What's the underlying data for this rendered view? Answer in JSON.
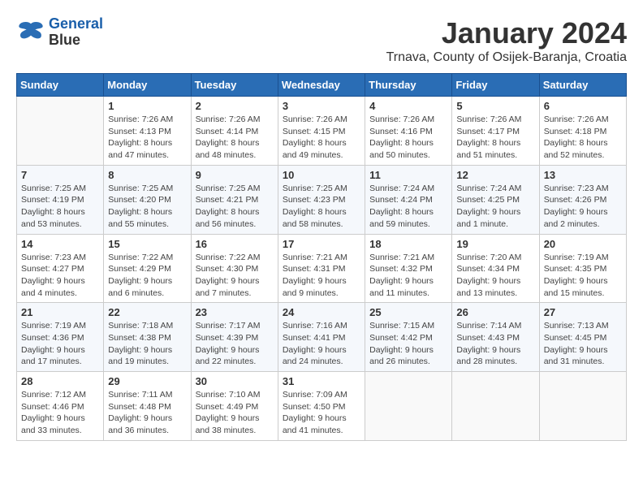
{
  "header": {
    "logo_line1": "General",
    "logo_line2": "Blue",
    "month_title": "January 2024",
    "location": "Trnava, County of Osijek-Baranja, Croatia"
  },
  "days_of_week": [
    "Sunday",
    "Monday",
    "Tuesday",
    "Wednesday",
    "Thursday",
    "Friday",
    "Saturday"
  ],
  "weeks": [
    [
      {
        "day": "",
        "info": ""
      },
      {
        "day": "1",
        "info": "Sunrise: 7:26 AM\nSunset: 4:13 PM\nDaylight: 8 hours\nand 47 minutes."
      },
      {
        "day": "2",
        "info": "Sunrise: 7:26 AM\nSunset: 4:14 PM\nDaylight: 8 hours\nand 48 minutes."
      },
      {
        "day": "3",
        "info": "Sunrise: 7:26 AM\nSunset: 4:15 PM\nDaylight: 8 hours\nand 49 minutes."
      },
      {
        "day": "4",
        "info": "Sunrise: 7:26 AM\nSunset: 4:16 PM\nDaylight: 8 hours\nand 50 minutes."
      },
      {
        "day": "5",
        "info": "Sunrise: 7:26 AM\nSunset: 4:17 PM\nDaylight: 8 hours\nand 51 minutes."
      },
      {
        "day": "6",
        "info": "Sunrise: 7:26 AM\nSunset: 4:18 PM\nDaylight: 8 hours\nand 52 minutes."
      }
    ],
    [
      {
        "day": "7",
        "info": "Sunrise: 7:25 AM\nSunset: 4:19 PM\nDaylight: 8 hours\nand 53 minutes."
      },
      {
        "day": "8",
        "info": "Sunrise: 7:25 AM\nSunset: 4:20 PM\nDaylight: 8 hours\nand 55 minutes."
      },
      {
        "day": "9",
        "info": "Sunrise: 7:25 AM\nSunset: 4:21 PM\nDaylight: 8 hours\nand 56 minutes."
      },
      {
        "day": "10",
        "info": "Sunrise: 7:25 AM\nSunset: 4:23 PM\nDaylight: 8 hours\nand 58 minutes."
      },
      {
        "day": "11",
        "info": "Sunrise: 7:24 AM\nSunset: 4:24 PM\nDaylight: 8 hours\nand 59 minutes."
      },
      {
        "day": "12",
        "info": "Sunrise: 7:24 AM\nSunset: 4:25 PM\nDaylight: 9 hours\nand 1 minute."
      },
      {
        "day": "13",
        "info": "Sunrise: 7:23 AM\nSunset: 4:26 PM\nDaylight: 9 hours\nand 2 minutes."
      }
    ],
    [
      {
        "day": "14",
        "info": "Sunrise: 7:23 AM\nSunset: 4:27 PM\nDaylight: 9 hours\nand 4 minutes."
      },
      {
        "day": "15",
        "info": "Sunrise: 7:22 AM\nSunset: 4:29 PM\nDaylight: 9 hours\nand 6 minutes."
      },
      {
        "day": "16",
        "info": "Sunrise: 7:22 AM\nSunset: 4:30 PM\nDaylight: 9 hours\nand 7 minutes."
      },
      {
        "day": "17",
        "info": "Sunrise: 7:21 AM\nSunset: 4:31 PM\nDaylight: 9 hours\nand 9 minutes."
      },
      {
        "day": "18",
        "info": "Sunrise: 7:21 AM\nSunset: 4:32 PM\nDaylight: 9 hours\nand 11 minutes."
      },
      {
        "day": "19",
        "info": "Sunrise: 7:20 AM\nSunset: 4:34 PM\nDaylight: 9 hours\nand 13 minutes."
      },
      {
        "day": "20",
        "info": "Sunrise: 7:19 AM\nSunset: 4:35 PM\nDaylight: 9 hours\nand 15 minutes."
      }
    ],
    [
      {
        "day": "21",
        "info": "Sunrise: 7:19 AM\nSunset: 4:36 PM\nDaylight: 9 hours\nand 17 minutes."
      },
      {
        "day": "22",
        "info": "Sunrise: 7:18 AM\nSunset: 4:38 PM\nDaylight: 9 hours\nand 19 minutes."
      },
      {
        "day": "23",
        "info": "Sunrise: 7:17 AM\nSunset: 4:39 PM\nDaylight: 9 hours\nand 22 minutes."
      },
      {
        "day": "24",
        "info": "Sunrise: 7:16 AM\nSunset: 4:41 PM\nDaylight: 9 hours\nand 24 minutes."
      },
      {
        "day": "25",
        "info": "Sunrise: 7:15 AM\nSunset: 4:42 PM\nDaylight: 9 hours\nand 26 minutes."
      },
      {
        "day": "26",
        "info": "Sunrise: 7:14 AM\nSunset: 4:43 PM\nDaylight: 9 hours\nand 28 minutes."
      },
      {
        "day": "27",
        "info": "Sunrise: 7:13 AM\nSunset: 4:45 PM\nDaylight: 9 hours\nand 31 minutes."
      }
    ],
    [
      {
        "day": "28",
        "info": "Sunrise: 7:12 AM\nSunset: 4:46 PM\nDaylight: 9 hours\nand 33 minutes."
      },
      {
        "day": "29",
        "info": "Sunrise: 7:11 AM\nSunset: 4:48 PM\nDaylight: 9 hours\nand 36 minutes."
      },
      {
        "day": "30",
        "info": "Sunrise: 7:10 AM\nSunset: 4:49 PM\nDaylight: 9 hours\nand 38 minutes."
      },
      {
        "day": "31",
        "info": "Sunrise: 7:09 AM\nSunset: 4:50 PM\nDaylight: 9 hours\nand 41 minutes."
      },
      {
        "day": "",
        "info": ""
      },
      {
        "day": "",
        "info": ""
      },
      {
        "day": "",
        "info": ""
      }
    ]
  ]
}
